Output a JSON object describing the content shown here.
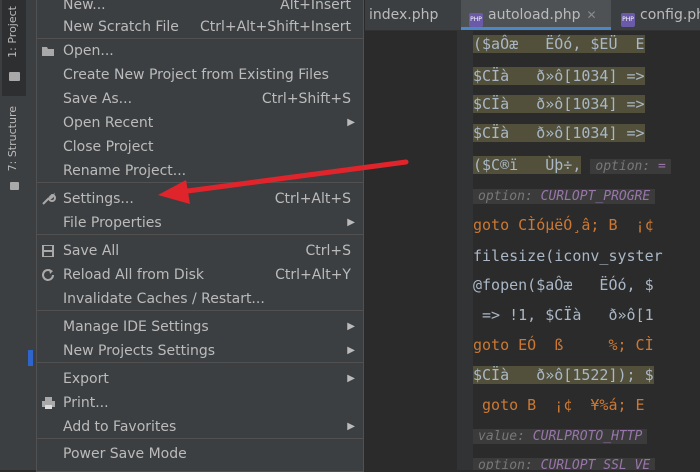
{
  "sidebar": {
    "project_tab": "1: Project",
    "structure_tab": "7: Structure"
  },
  "editor": {
    "tabs": [
      "index.php",
      "autoload.php",
      "config.php"
    ],
    "lines": [
      {
        "t": "($aÔæ   ËÓó, $EÜ  E"
      },
      {
        "t": "$CÏà   ð»ô[1034] =>"
      },
      {
        "t": "$CÏà   ð»ô[1034] =>"
      },
      {
        "t": "$CÏà   ð»ô[1034] =>"
      },
      {
        "t": "($C®ï   Ùþ÷,",
        "hint": "option:",
        "hint_value": "="
      },
      {
        "hint": "option:",
        "hint_value": "CURLOPT_PROGRE"
      },
      {
        "t": "goto CÌóµëÓ¸â; B  ¡¢"
      },
      {
        "t": "filesize(iconv_syster"
      },
      {
        "t": "@fopen($aÔæ   ËÓó, $"
      },
      {
        "t": " => !1, $CÏà   ð»ô[1"
      },
      {
        "t": "goto EÓ  ß     %; CÌ"
      },
      {
        "t": "$CÏà   ð»ô[1522]); $"
      },
      {
        "t": " goto B  ¡¢  ¥%á; E"
      },
      {
        "hint": "value:",
        "hint_value": "CURLPROTO_HTTP"
      },
      {
        "hint": "option:",
        "hint_value": "CURLOPT_SSL_VE"
      }
    ]
  },
  "menu": {
    "new": {
      "label": "New...",
      "shortcut": "Alt+Insert"
    },
    "new_scratch": {
      "label": "New Scratch File",
      "shortcut": "Ctrl+Alt+Shift+Insert"
    },
    "open": {
      "label": "Open..."
    },
    "create_from_existing": {
      "label": "Create New Project from Existing Files"
    },
    "save_as": {
      "label": "Save As...",
      "shortcut": "Ctrl+Shift+S"
    },
    "open_recent": {
      "label": "Open Recent"
    },
    "close_project": {
      "label": "Close Project"
    },
    "rename_project": {
      "label": "Rename Project..."
    },
    "settings": {
      "label": "Settings...",
      "shortcut": "Ctrl+Alt+S"
    },
    "file_properties": {
      "label": "File Properties"
    },
    "save_all": {
      "label": "Save All",
      "shortcut": "Ctrl+S"
    },
    "reload_all": {
      "label": "Reload All from Disk",
      "shortcut": "Ctrl+Alt+Y"
    },
    "invalidate_caches": {
      "label": "Invalidate Caches / Restart..."
    },
    "manage_ide": {
      "label": "Manage IDE Settings"
    },
    "new_projects_settings": {
      "label": "New Projects Settings"
    },
    "export": {
      "label": "Export"
    },
    "print": {
      "label": "Print..."
    },
    "add_to_favorites": {
      "label": "Add to Favorites"
    },
    "power_save": {
      "label": "Power Save Mode"
    }
  },
  "icons": {
    "folder": "folder-icon",
    "structure": "structure-icon",
    "open_folder": "open-folder-icon",
    "wrench": "wrench-icon",
    "save": "save-icon",
    "reload": "reload-icon",
    "print": "printer-icon",
    "submenu": "chevron-right-icon",
    "php": "php-file-icon",
    "annotation": "red-arrow-icon"
  },
  "colors": {
    "accent": "#4a88c7",
    "annotation_arrow": "#e0242c",
    "menu_bg": "#3c3f41",
    "editor_bg": "#2b2b2b"
  }
}
